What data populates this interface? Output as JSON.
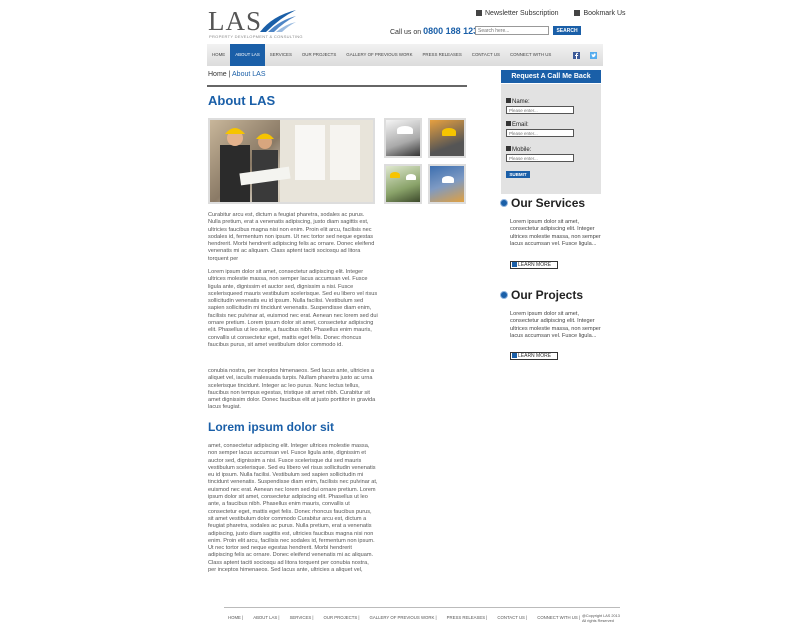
{
  "brand": {
    "logo_text": "LAS",
    "logo_sub": "PROPERTY DEVELOPMENT & CONSULTING"
  },
  "toplinks": {
    "newsletter": "Newsletter Subscription",
    "bookmark": "Bookmark Us"
  },
  "contact": {
    "callus_label": "Call us on",
    "phone": "0800 188 1234"
  },
  "search": {
    "placeholder": "Search here...",
    "button": "SEARCH"
  },
  "nav": {
    "items": [
      "HOME",
      "ABOUT LAS",
      "SERVICES",
      "OUR PROJECTS",
      "GALLERY OF PREVIOUS WORK",
      "PRESS RELEASES",
      "CONTACT US",
      "CONNECT WITH US"
    ],
    "active_index": 1
  },
  "breadcrumb": {
    "home": "Home",
    "sep": " | ",
    "current": "About LAS"
  },
  "main": {
    "title": "About LAS",
    "p1": "Curabitur arcu est, dictum a feugiat pharetra, sodales ac purus. Nulla pretium, erat a venenatis adipiscing, justo diam sagittis est, ultricies faucibus magna nisi non enim. Proin elit arcu, facilisis nec sodales id, fermentum non ipsum. Ut nec tortor sed neque egestas hendrerit. Morbi hendrerit adipiscing felis ac ornare. Donec eleifend venenatis mi ac aliquam. Class aptent taciti sociosqu ad litora torquent per",
    "p2": "Lorem ipsum dolor sit amet, consectetur adipiscing elit. Integer ultrices molestie massa, non semper lacus accumsan vel. Fusce ligula ante, dignissim et auctor sed, dignissim a nisi. Fusce scelerisqueed mauris vestibulum scelerisque. Sed eu libero vel risus sollicitudin venenatis eu id ipsum. Nulla facilisi. Vestibulum sed sapien sollicitudin mi tincidunt venenatis. Suspendisse diam enim, facilisis nec pulvinar at, euismod nec erat. Aenean nec lorem sed dui ornare pretium. Lorem ipsum dolor sit amet, consectetur adipiscing elit. Phasellus ut leo ante, a faucibus nibh. Phasellus enim mauris, convallis ut consectetur eget, mattis eget felis. Donec rhoncus faucibus purus, sit amet vestibulum dolor commodo id.",
    "p3": "conubia nostra, per inceptos himenaeos. Sed lacus ante, ultricies a aliquet vel, iaculis malesuada turpis. Nullam pharetra justo ac urna scelerisque tincidunt. Integer ac leo purus. Nunc lectus tellus, faucibus non tempus egestas, tristique sit amet nibh. Curabitur sit amet dignissim dolor. Donec faucibus elit at justo porttitor in gravida lacus feugiat.",
    "subtitle": "Lorem ipsum dolor sit",
    "p4": "amet, consectetur adipiscing elit. Integer ultrices molestie massa, non semper lacus accumsan vel. Fusce ligula ante, dignissim et auctor sed, dignissim a nisi. Fusce scelerisque dui sed mauris vestibulum scelerisque. Sed eu libero vel risus sollicitudin venenatis eu id ipsum. Nulla facilisi. Vestibulum sed sapien sollicitudin mi tincidunt venenatis. Suspendisse diam enim, facilisis nec pulvinar at, euismod nec erat. Aenean nec lorem sed dui ornare pretium. Lorem ipsum dolor sit amet, consectetur adipiscing elit. Phasellus ut leo ante, a faucibus nibh. Phasellus enim mauris, convallis ut consectetur eget, mattis eget felis. Donec rhoncus faucibus purus, sit amet vestibulum dolor commodo Curabitur arcu est, dictum a feugiat pharetra, sodales ac purus. Nulla pretium, erat a venenatis adipiscing, justo diam sagittis est, ultricies faucibus magna nisi non enim. Proin elit arcu, facilisis nec sodales id, fermentum non ipsum. Ut nec tortor sed neque egestas hendrerit. Morbi hendrerit adipiscing felis ac ornare. Donec eleifend venenatis mi ac aliquam. Class aptent taciti sociosqu ad litora torquent per conubia nostra, per inceptos himenaeos. Sed lacus ante, ultricies a aliquet vel,"
  },
  "sidebar": {
    "callback_title": "Request A Call Me Back",
    "name_label": "Name:",
    "email_label": "Email:",
    "mobile_label": "Mobile:",
    "input_placeholder": "Please enter...",
    "submit": "SUBMIT",
    "services_title": "Our Services",
    "services_text": "Lorem ipsum dolor sit amet, consectetur adipiscing elit. Integer ultrices molestie massa, non semper lacus accumsan vel. Fusce ligula...",
    "projects_title": "Our Projects",
    "projects_text": "Lorem ipsum dolor sit amet, consectetur adipiscing elit. Integer ultrices molestie massa, non semper lacus accumsan vel. Fusce ligula...",
    "learn_more": "LEARN MORE"
  },
  "footer": {
    "items": [
      "HOME |",
      "ABOUT LAS |",
      "SERVICES |",
      "OUR PROJECTS |",
      "GALLERY OF PREVIOUS WORK |",
      "PRESS RELEASES |",
      "CONTACT US |",
      "CONNECT WITH US |"
    ],
    "copyright": "@Copyright LAS 2013 All rights Reserved"
  },
  "colors": {
    "accent": "#1a5fa8",
    "sidebar_bg": "#e2e2e2"
  }
}
